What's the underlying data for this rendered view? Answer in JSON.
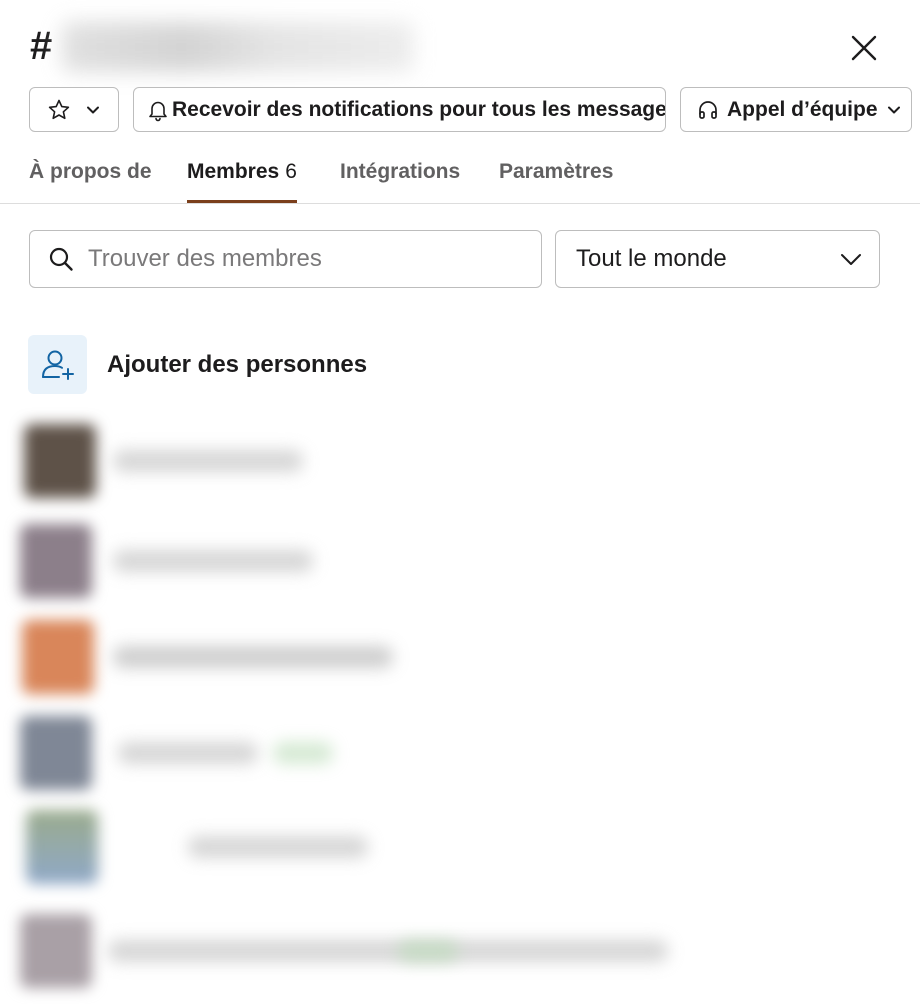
{
  "header": {
    "hash_symbol": "#",
    "close_icon": "close-icon"
  },
  "toolbar": {
    "star_icon": "star-icon",
    "notifications_label": "Recevoir des notifications pour tous les messages",
    "call_label": "Appel d’équipe"
  },
  "tabs": [
    {
      "label": "À propos de",
      "active": false
    },
    {
      "label": "Membres",
      "count": "6",
      "active": true
    },
    {
      "label": "Intégrations",
      "active": false
    },
    {
      "label": "Paramètres",
      "active": false
    }
  ],
  "search": {
    "placeholder": "Trouver des membres"
  },
  "filter": {
    "selected": "Tout le monde"
  },
  "add_people": {
    "label": "Ajouter des personnes"
  },
  "colors": {
    "accent_tab_underline": "#7b3f1c",
    "add_icon_bg": "#e8f2fa",
    "add_icon_stroke": "#1264a3",
    "border": "#bdbdbd"
  }
}
